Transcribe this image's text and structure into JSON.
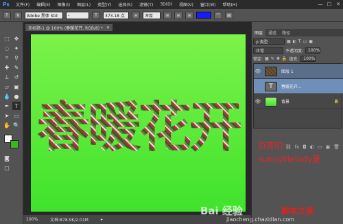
{
  "menubar": {
    "logo": "Ps",
    "items": [
      "文件(F)",
      "编辑(E)",
      "图像(I)",
      "图层(L)",
      "类型(Y)",
      "选择(S)",
      "滤镜(T)",
      "3D(D)",
      "视图(V)",
      "窗口(W)",
      "帮助(H)"
    ],
    "controls": [
      "—",
      "□",
      "✕"
    ]
  },
  "options": {
    "font_family": "Adobe 黑体 Std",
    "font_style": "-",
    "font_size": "373.18 点",
    "aa": "浑厚",
    "color_swatch": "#1a1aff"
  },
  "document": {
    "tab_title": "未标题-1 @ 100% (春暖花开, RGB/8) *",
    "canvas_text": "春暖花开",
    "zoom": "100%",
    "doc_info": "文档:878.9K/2.01M"
  },
  "panels": {
    "tabs": [
      "图层",
      "通道",
      "路径"
    ],
    "kind_label": "ρ 类型",
    "blend_mode": "正常",
    "opacity_label": "不透明度:",
    "opacity_value": "100%",
    "lock_label": "锁定:",
    "fill_label": "填充:",
    "fill_value": "100%",
    "layers": [
      {
        "name": "图层 1"
      },
      {
        "name": "春暖花开..."
      },
      {
        "name": "背景"
      }
    ]
  },
  "annotation": {
    "line1": "百度ID:",
    "line2": "sunnyMelody夏"
  },
  "watermark": {
    "baidu": "Bai 经验",
    "site": "jiaocheng.chazidian.com",
    "brand": "脚本之家"
  },
  "colors": {
    "fg": "#ffffff",
    "bg": "#3cb81e",
    "canvas_top": "#7cf24a",
    "annotation": "#e0282a"
  }
}
